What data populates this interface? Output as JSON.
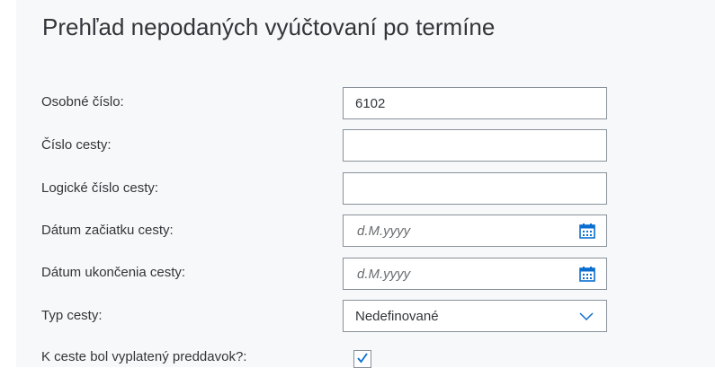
{
  "title": "Prehľad nepodaných vyúčtovaní po termíne",
  "fields": {
    "personal_number": {
      "label": "Osobné číslo:",
      "value": "6102"
    },
    "trip_number": {
      "label": "Číslo cesty:",
      "value": ""
    },
    "logical_trip_number": {
      "label": "Logické číslo cesty:",
      "value": ""
    },
    "trip_start_date": {
      "label": "Dátum začiatku cesty:",
      "placeholder": "d.M.yyyy",
      "icon": "calendar-icon"
    },
    "trip_end_date": {
      "label": "Dátum ukončenia cesty:",
      "placeholder": "d.M.yyyy",
      "icon": "calendar-icon"
    },
    "trip_type": {
      "label": "Typ cesty:",
      "value": "Nedefinované",
      "icon": "chevron-down-icon"
    },
    "advance_paid": {
      "label": "K ceste bol vyplatený preddavok?:",
      "checked": true
    }
  },
  "colors": {
    "panel_bg": "#f7f8f9",
    "input_border": "#89919a",
    "text": "#32363a",
    "accent": "#0a6ed1"
  }
}
